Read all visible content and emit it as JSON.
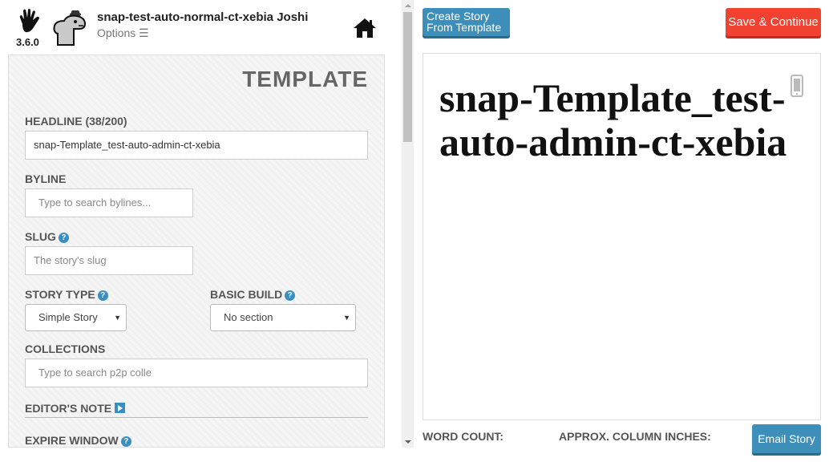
{
  "header": {
    "version": "3.6.0",
    "user_name": "snap-test-auto-normal-ct-xebia Joshi",
    "options_label": "Options ☰",
    "logo_icon": "hand-logo-icon",
    "avatar_icon": "dinosaur-avatar-icon",
    "home_icon": "home-icon"
  },
  "panel": {
    "title": "TEMPLATE",
    "headline_label": "HEADLINE (38/200)",
    "headline_value": "snap-Template_test-auto-admin-ct-xebia",
    "byline_label": "BYLINE",
    "byline_placeholder": "Type to search bylines...",
    "slug_label": "SLUG",
    "slug_placeholder": "The story's slug",
    "story_type_label": "STORY TYPE",
    "story_type_value": "Simple Story",
    "basic_build_label": "BASIC BUILD",
    "basic_build_value": "No section",
    "collections_label": "COLLECTIONS",
    "collections_placeholder": "Type to search p2p colle",
    "editors_note_label": "EDITOR'S NOTE",
    "expire_window_label": "EXPIRE WINDOW",
    "help_glyph": "?"
  },
  "toolbar": {
    "create_line1": "Create Story",
    "create_line2": "From Template",
    "save_label": "Save & Continue"
  },
  "preview": {
    "headline": "snap-Template_test-auto-admin-ct-xebia",
    "device_icon": "mobile-phone-icon"
  },
  "footer": {
    "word_count_label": "WORD COUNT:",
    "column_inches_label": "APPROX. COLUMN INCHES:",
    "email_label": "Email Story"
  },
  "colors": {
    "accent_blue": "#3d8fb9",
    "save_red": "#f04131"
  }
}
